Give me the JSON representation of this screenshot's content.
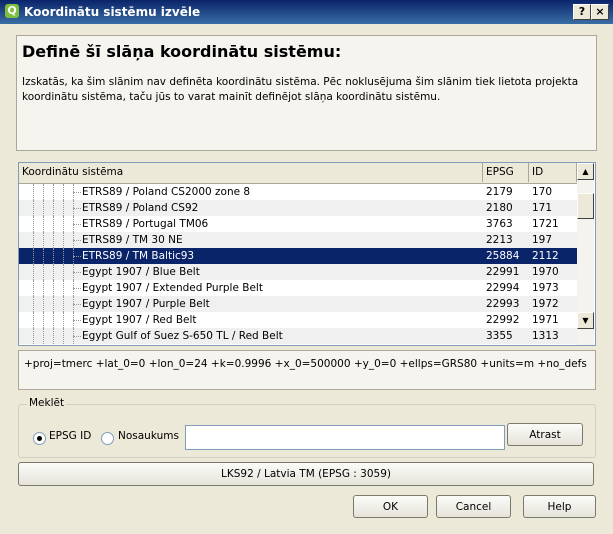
{
  "window": {
    "title": "Koordinātu sistēmu izvēle",
    "app_icon": "qgis-icon",
    "help_glyph": "?",
    "close_glyph": "×"
  },
  "header": {
    "heading": "Definē šī slāņa koordinātu sistēmu:",
    "description": "Izskatās, ka šim slānim nav definēta koordinātu sistēma. Pēc noklusējuma šim slānim tiek lietota projekta koordinātu sistēma, taču jūs to varat mainīt definējot slāņa koordinātu sistēmu."
  },
  "tree": {
    "columns": [
      "Koordinātu sistēma",
      "EPSG",
      "ID"
    ],
    "rows": [
      {
        "name": "ETRS89 / Poland CS2000 zone 8",
        "epsg": "2179",
        "id": "170"
      },
      {
        "name": "ETRS89 / Poland CS92",
        "epsg": "2180",
        "id": "171"
      },
      {
        "name": "ETRS89 / Portugal TM06",
        "epsg": "3763",
        "id": "1721"
      },
      {
        "name": "ETRS89 / TM 30 NE",
        "epsg": "2213",
        "id": "197"
      },
      {
        "name": "ETRS89 / TM Baltic93",
        "epsg": "25884",
        "id": "2112"
      },
      {
        "name": "Egypt 1907 / Blue Belt",
        "epsg": "22991",
        "id": "1970"
      },
      {
        "name": "Egypt 1907 / Extended Purple Belt",
        "epsg": "22994",
        "id": "1973"
      },
      {
        "name": "Egypt 1907 / Purple Belt",
        "epsg": "22993",
        "id": "1972"
      },
      {
        "name": "Egypt 1907 / Red Belt",
        "epsg": "22992",
        "id": "1971"
      },
      {
        "name": "Egypt Gulf of Suez S-650 TL / Red Belt",
        "epsg": "3355",
        "id": "1313"
      }
    ],
    "selected_index": 4,
    "scroll_up_glyph": "▲",
    "scroll_down_glyph": "▼"
  },
  "proj_string": "+proj=tmerc +lat_0=0 +lon_0=24 +k=0.9996 +x_0=500000 +y_0=0 +ellps=GRS80 +units=m +no_defs",
  "search": {
    "group_label": "Meklēt",
    "option_epsg": "EPSG ID",
    "option_name": "Nosaukums",
    "selected": "EPSG ID",
    "query": "",
    "find_label": "Atrast"
  },
  "selected_crs": "LKS92 / Latvia TM (EPSG : 3059)",
  "buttons": {
    "ok": "OK",
    "cancel": "Cancel",
    "help": "Help"
  },
  "colors": {
    "selection": "#0a246a",
    "titlebar": "#0a246a"
  }
}
